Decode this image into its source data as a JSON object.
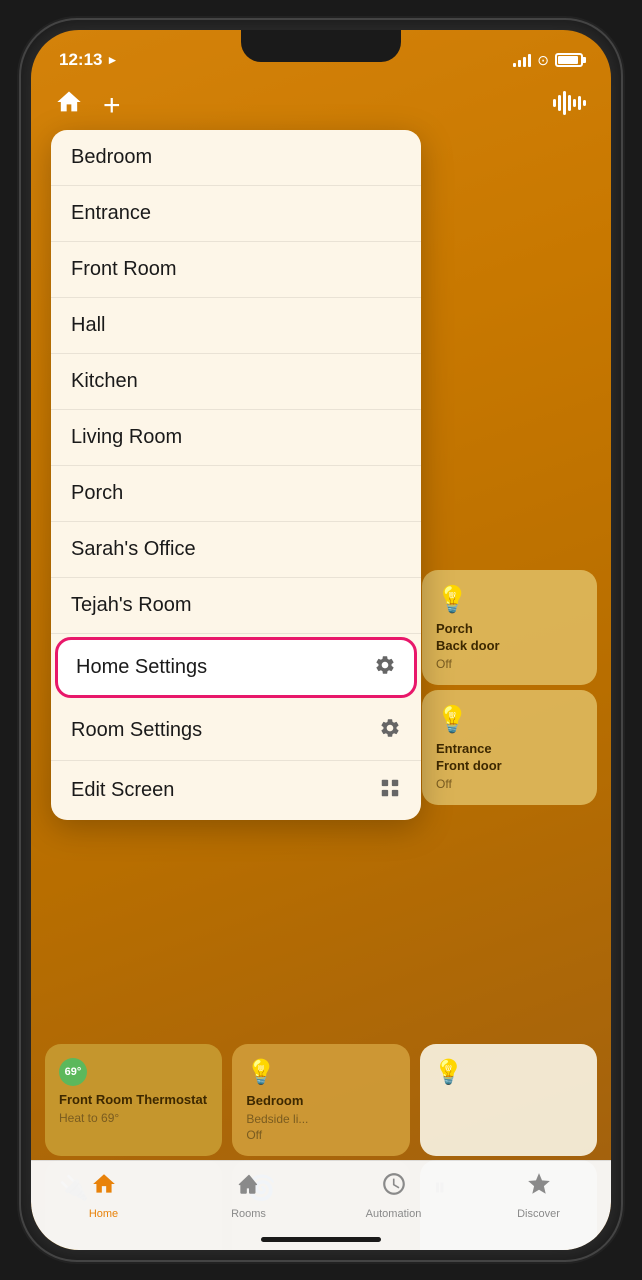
{
  "status_bar": {
    "time": "12:13",
    "location_icon": "▶",
    "battery_full": true
  },
  "top_nav": {
    "home_icon": "⌂",
    "add_icon": "+",
    "waveform_icon": "|||"
  },
  "dropdown_menu": {
    "items": [
      {
        "id": "bedroom",
        "label": "Bedroom",
        "icon": ""
      },
      {
        "id": "entrance",
        "label": "Entrance",
        "icon": ""
      },
      {
        "id": "front-room",
        "label": "Front Room",
        "icon": ""
      },
      {
        "id": "hall",
        "label": "Hall",
        "icon": ""
      },
      {
        "id": "kitchen",
        "label": "Kitchen",
        "icon": ""
      },
      {
        "id": "living-room",
        "label": "Living Room",
        "icon": ""
      },
      {
        "id": "porch",
        "label": "Porch",
        "icon": ""
      },
      {
        "id": "sarahs-office",
        "label": "Sarah's Office",
        "icon": ""
      },
      {
        "id": "tejahs-room",
        "label": "Tejah's Room",
        "icon": ""
      },
      {
        "id": "home-settings",
        "label": "Home Settings",
        "icon": "gear",
        "highlighted": true
      },
      {
        "id": "room-settings",
        "label": "Room Settings",
        "icon": "gear"
      },
      {
        "id": "edit-screen",
        "label": "Edit Screen",
        "icon": "grid"
      }
    ]
  },
  "tiles": {
    "porch_back_door": {
      "title": "Porch",
      "subtitle": "Back door",
      "status": "Off"
    },
    "entrance_front_door": {
      "title": "Entrance",
      "subtitle": "Front door",
      "status": "Off"
    },
    "front_room_thermostat": {
      "title": "Front Room Thermostat",
      "subtitle": "Heat to 69°",
      "temp": "69°"
    },
    "bedroom_bedside": {
      "title": "Bedroom",
      "subtitle": "Bedside li...",
      "status": "Off"
    }
  },
  "bottom_nav": {
    "tabs": [
      {
        "id": "home",
        "label": "Home",
        "icon": "home",
        "active": true
      },
      {
        "id": "rooms",
        "label": "Rooms",
        "icon": "rooms",
        "active": false
      },
      {
        "id": "automation",
        "label": "Automation",
        "icon": "automation",
        "active": false
      },
      {
        "id": "discover",
        "label": "Discover",
        "icon": "discover",
        "active": false
      }
    ]
  }
}
